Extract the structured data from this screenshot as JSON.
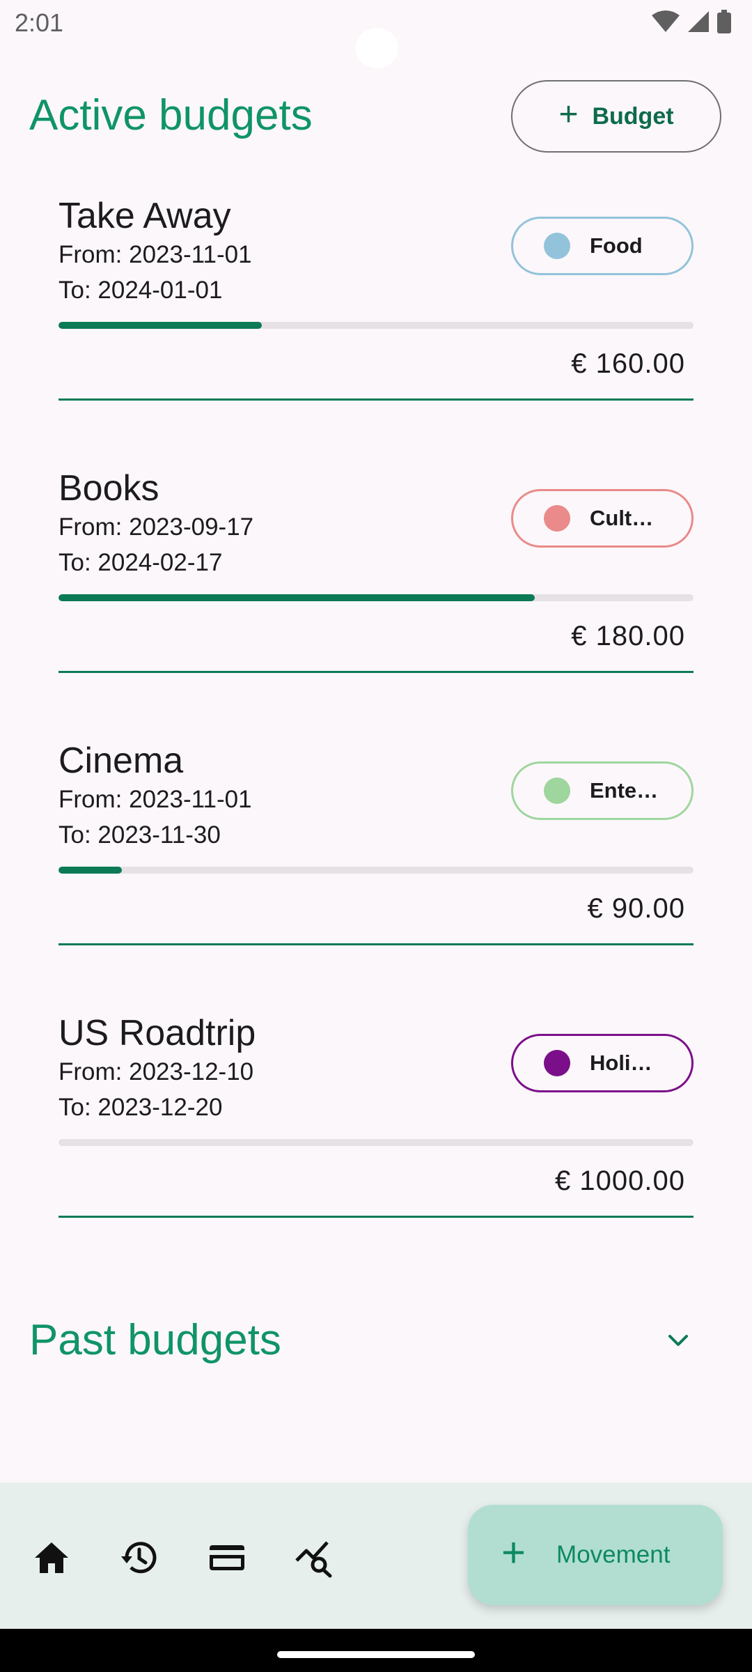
{
  "status_bar": {
    "time": "2:01"
  },
  "header": {
    "title": "Active budgets",
    "add_button_label": "Budget"
  },
  "budgets": [
    {
      "name": "Take Away",
      "from": "From: 2023-11-01",
      "to": "To: 2024-01-01",
      "category": "Food",
      "category_color": "#92c3da",
      "progress": 0.32,
      "amount": "€ 160.00"
    },
    {
      "name": "Books",
      "from": "From: 2023-09-17",
      "to": "To: 2024-02-17",
      "category": "Cult…",
      "category_color": "#ea8a8a",
      "progress": 0.75,
      "amount": "€ 180.00"
    },
    {
      "name": "Cinema",
      "from": "From: 2023-11-01",
      "to": "To: 2023-11-30",
      "category": "Ente…",
      "category_color": "#9ed69e",
      "progress": 0.1,
      "amount": "€ 90.00"
    },
    {
      "name": "US Roadtrip",
      "from": "From: 2023-12-10",
      "to": "To: 2023-12-20",
      "category": "Holi…",
      "category_color": "#7b0f8a",
      "progress": 0.0,
      "amount": "€ 1000.00"
    }
  ],
  "past": {
    "title": "Past budgets"
  },
  "nav": {
    "items": [
      "home-icon",
      "history-icon",
      "card-icon",
      "analytics-icon"
    ]
  },
  "fab": {
    "label": "Movement"
  },
  "colors": {
    "accent": "#0f9467",
    "progress": "#0b7a55",
    "background": "#fcf7fa",
    "nav_background": "#e7efed",
    "fab_background": "#b2ded2"
  }
}
